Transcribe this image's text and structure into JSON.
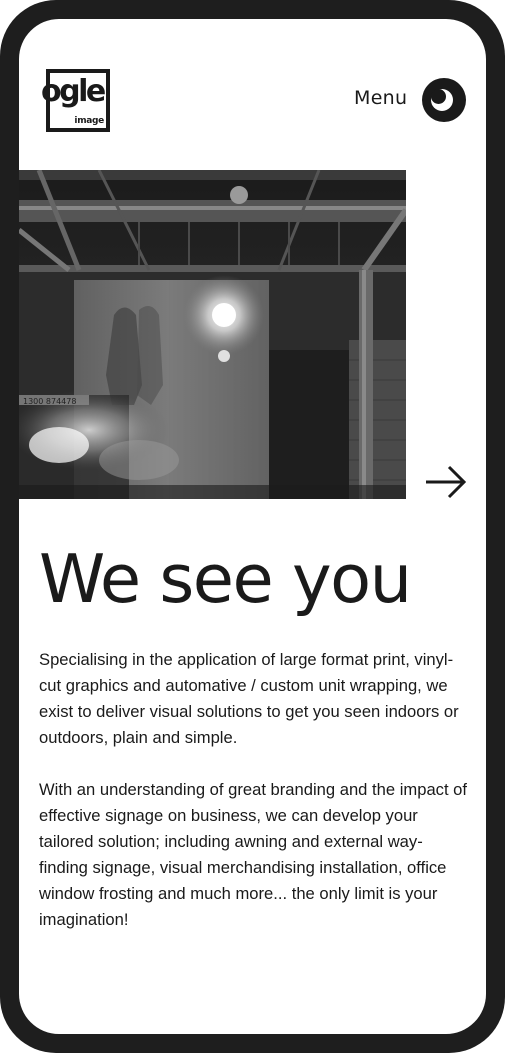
{
  "header": {
    "logo": {
      "word": "ogle",
      "sub": "image"
    },
    "menu_label": "Menu",
    "menu_icon": "eye-icon"
  },
  "hero": {
    "image_alt": "Warehouse interior with frosted glass panel and motion-blurred figure",
    "next_icon": "arrow-right-icon",
    "sign_text": "1300 874478"
  },
  "main": {
    "headline": "We see you",
    "paragraphs": [
      "Specialising in the application of large format print, vinyl-cut graphics and automative / custom unit wrapping, we exist to deliver visual solutions to get you seen indoors or outdoors, plain and simple.",
      "With an understanding of great branding and the impact of effective signage on business, we can develop your tailored solution; including awning and external way-finding signage, visual merchandising installation, office window frosting and much more... the only limit is your imagination!"
    ]
  },
  "colors": {
    "frame": "#1e1e1e",
    "text": "#1a1a1a",
    "background": "#ffffff"
  }
}
